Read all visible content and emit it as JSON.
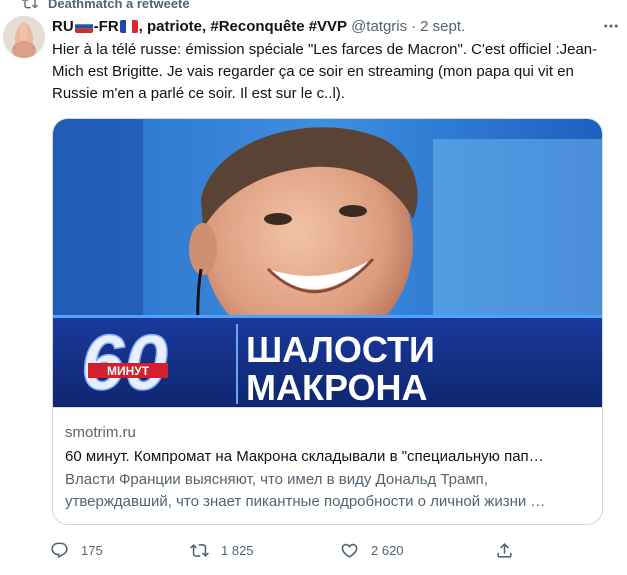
{
  "retweet": {
    "text": "Deathmatch a retweeté"
  },
  "tweet": {
    "author_name_part1": "RU",
    "author_name_part2": "-FR",
    "author_name_part3": ", patriote, #Reconquête #VVP",
    "handle": "@tatgris",
    "separator": "·",
    "time": "2 sept.",
    "text": "Hier à la télé russe: émission spéciale \"Les farces de Macron\". C'est officiel :Jean-Mich est Brigitte. Je vais regarder ça ce soir en streaming (mon papa qui vit en Russie m'en a parlé ce soir. Il est sur le c..l)."
  },
  "card": {
    "overlay_number": "60",
    "overlay_sub": "МИНУТ",
    "overlay_line1": "ШАЛОСТИ",
    "overlay_line2": "МАКРОНА",
    "domain": "smotrim.ru",
    "title": "60 минут. Компромат на Макрона складывали в \"специальную пап…",
    "desc_line1": "Власти Франции выясняют, что имел в виду Дональд Трамп,",
    "desc_line2": "утверждавший, что знает пикантные подробности о личной жизни …"
  },
  "actions": {
    "replies": "175",
    "retweets": "1 825",
    "likes": "2 620"
  },
  "icons": {
    "retweet": "retweet-icon",
    "more": "more-icon",
    "reply": "reply-icon",
    "like": "heart-icon",
    "share": "share-icon"
  },
  "colors": {
    "text_primary": "#0f1419",
    "text_secondary": "#536471",
    "border": "#cfd9de",
    "overlay_blue": "#1a3a9c"
  }
}
